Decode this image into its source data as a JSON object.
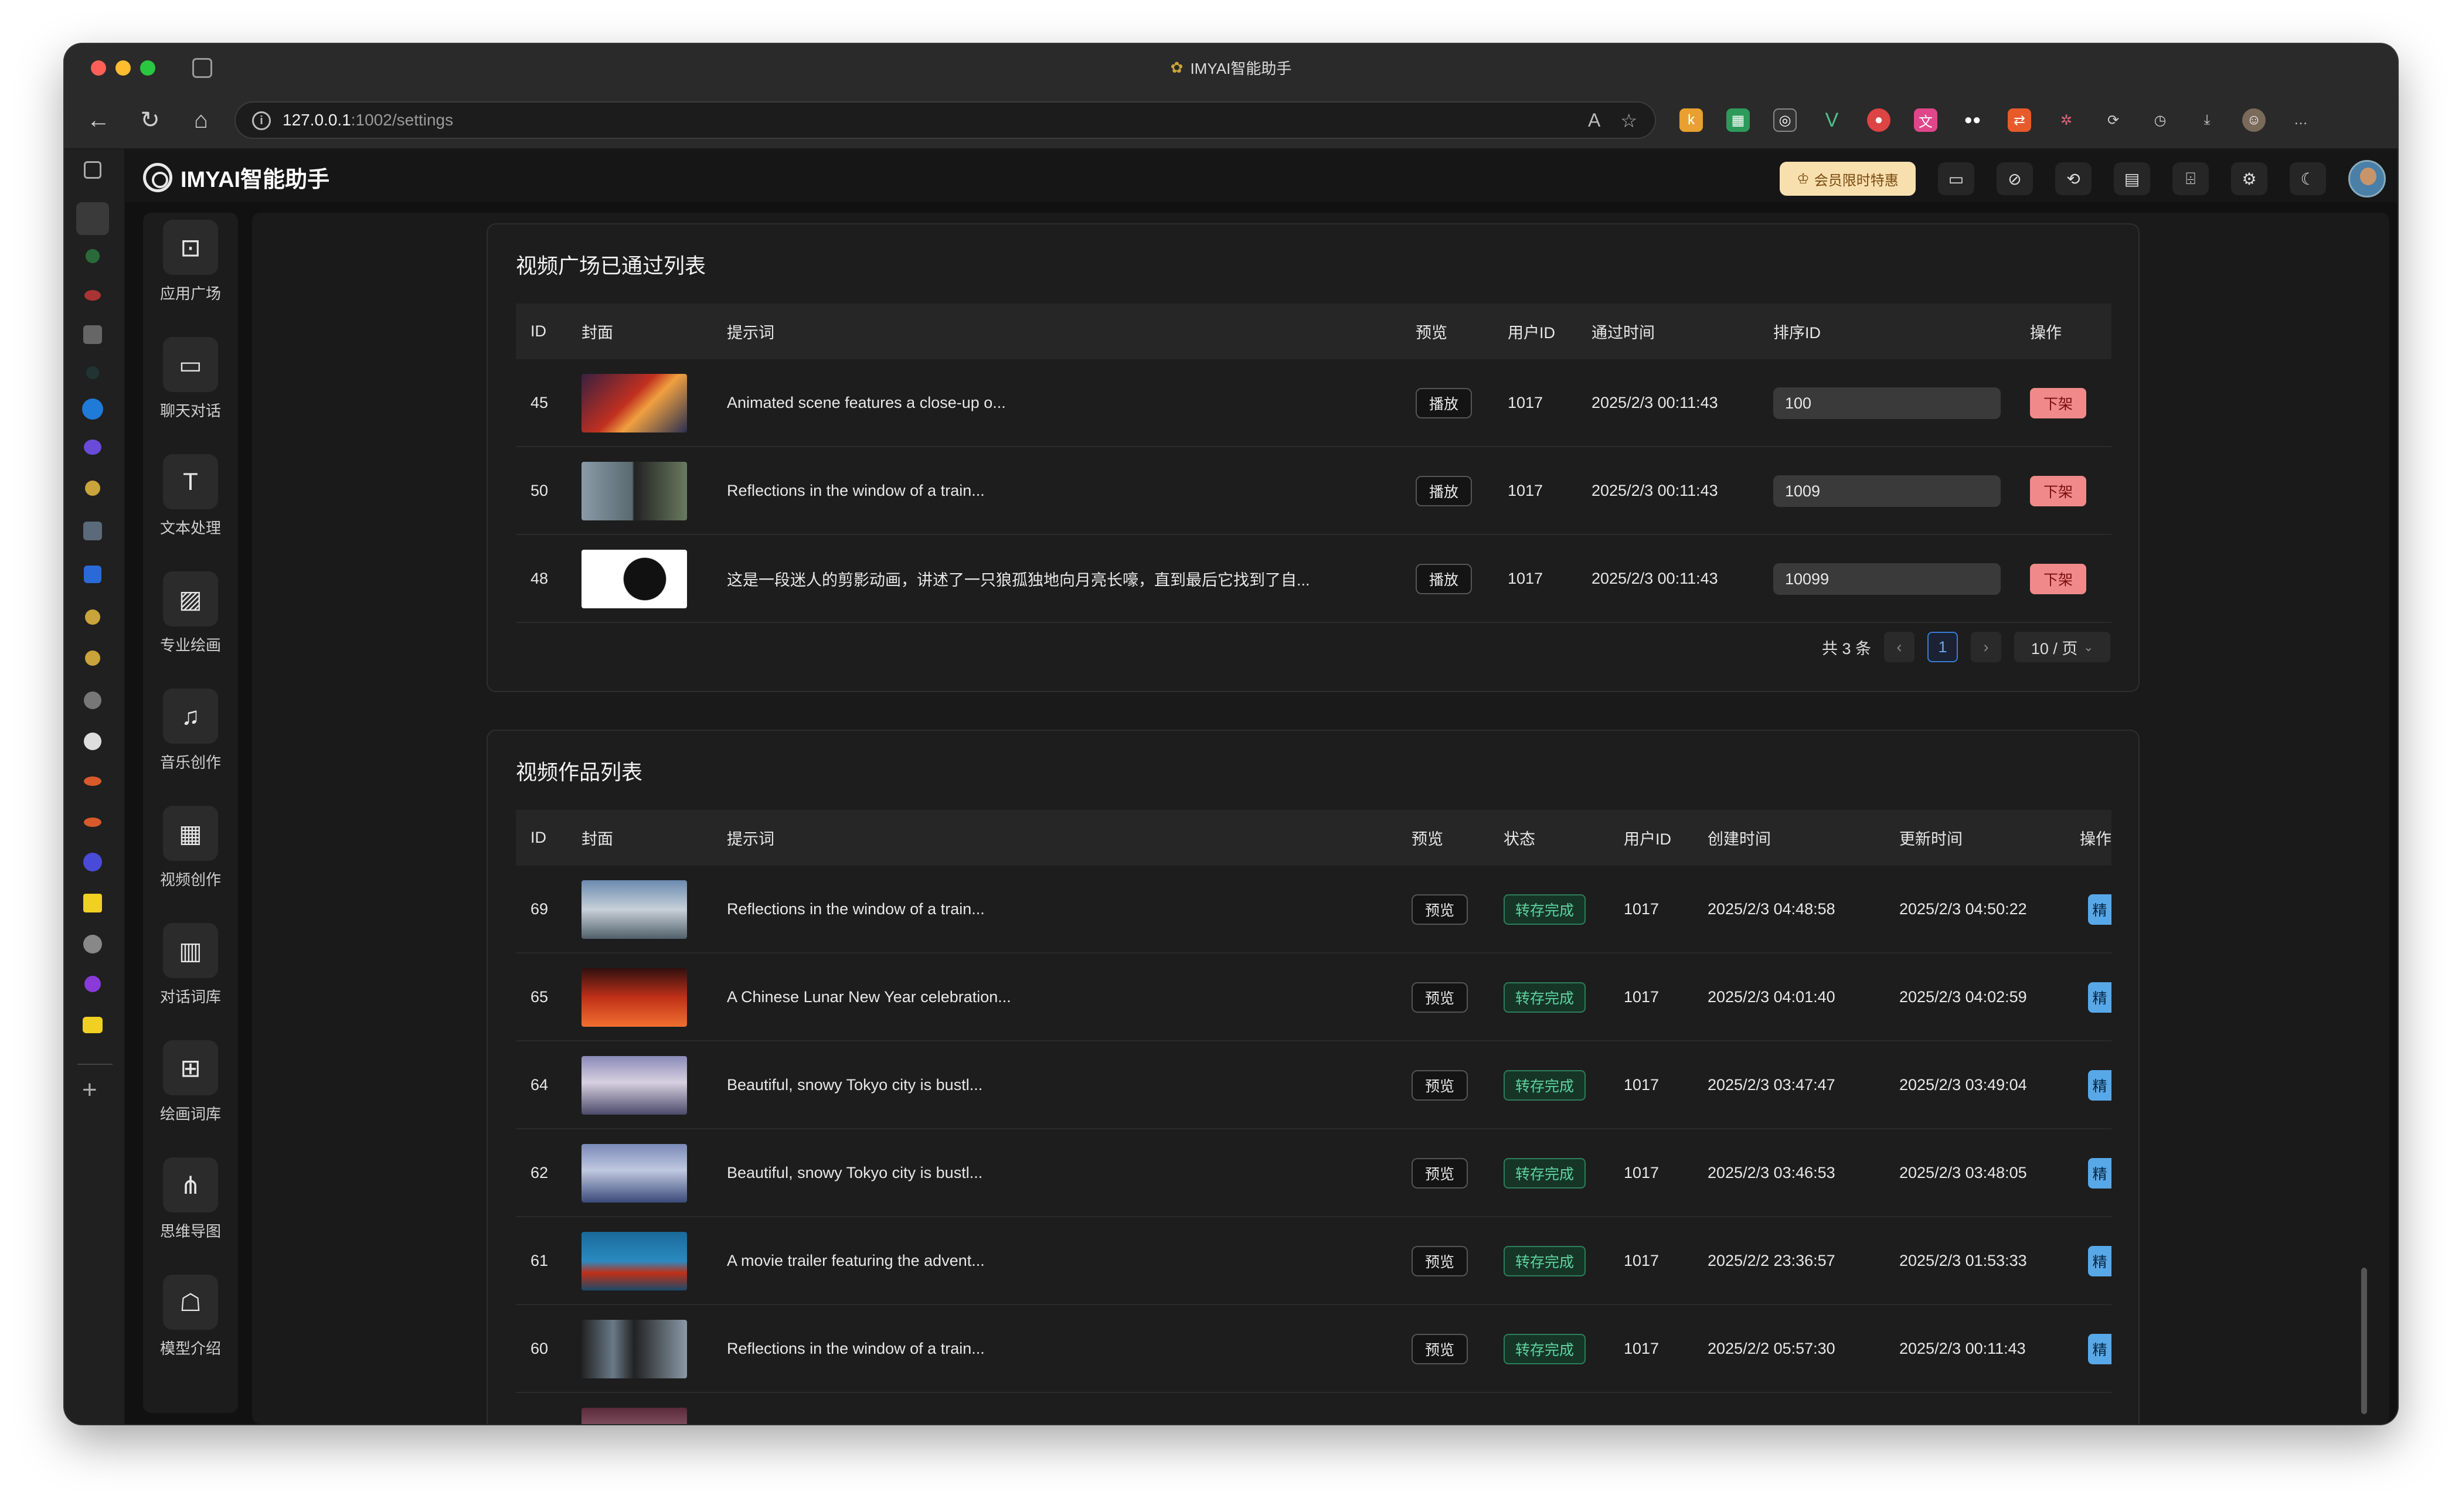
{
  "browser": {
    "window_title": "IMYAI智能助手",
    "url_host": "127.0.0.1",
    "url_path": ":1002/settings"
  },
  "app": {
    "logo_text": "IMYAI智能助手",
    "vip_label": "会员限时特惠"
  },
  "nav": [
    {
      "label": "应用广场",
      "icon": "app-square-icon"
    },
    {
      "label": "聊天对话",
      "icon": "chat-icon"
    },
    {
      "label": "文本处理",
      "icon": "text-icon"
    },
    {
      "label": "专业绘画",
      "icon": "image-icon"
    },
    {
      "label": "音乐创作",
      "icon": "music-icon"
    },
    {
      "label": "视频创作",
      "icon": "video-icon"
    },
    {
      "label": "对话词库",
      "icon": "book-icon"
    },
    {
      "label": "绘画词库",
      "icon": "gallery-icon"
    },
    {
      "label": "思维导图",
      "icon": "mindmap-icon"
    },
    {
      "label": "模型介绍",
      "icon": "robot-icon"
    }
  ],
  "approved": {
    "title": "视频广场已通过列表",
    "headers": {
      "id": "ID",
      "cover": "封面",
      "prompt": "提示词",
      "preview": "预览",
      "user_id": "用户ID",
      "pass_time": "通过时间",
      "sort_id": "排序ID",
      "action": "操作"
    },
    "play_label": "播放",
    "off_label": "下架",
    "rows": [
      {
        "id": "45",
        "prompt": "Animated scene features a close-up o...",
        "user_id": "1017",
        "time": "2025/2/3 00:11:43",
        "sort": "100"
      },
      {
        "id": "50",
        "prompt": "Reflections in the window of a train...",
        "user_id": "1017",
        "time": "2025/2/3 00:11:43",
        "sort": "1009"
      },
      {
        "id": "48",
        "prompt": "这是一段迷人的剪影动画，讲述了一只狼孤独地向月亮长嚎，直到最后它找到了自...",
        "user_id": "1017",
        "time": "2025/2/3 00:11:43",
        "sort": "10099"
      }
    ],
    "pager": {
      "total": "共 3 条",
      "page": "1",
      "size": "10 / 页"
    }
  },
  "works": {
    "title": "视频作品列表",
    "headers": {
      "id": "ID",
      "cover": "封面",
      "prompt": "提示词",
      "preview": "预览",
      "status": "状态",
      "user_id": "用户ID",
      "created": "创建时间",
      "updated": "更新时间",
      "action": "操作"
    },
    "preview_label": "预览",
    "status_label": "转存完成",
    "action_label": "精",
    "rows": [
      {
        "id": "69",
        "prompt": "Reflections in the window of a train...",
        "user_id": "1017",
        "created": "2025/2/3 04:48:58",
        "updated": "2025/2/3 04:50:22"
      },
      {
        "id": "65",
        "prompt": "A Chinese Lunar New Year celebration...",
        "user_id": "1017",
        "created": "2025/2/3 04:01:40",
        "updated": "2025/2/3 04:02:59"
      },
      {
        "id": "64",
        "prompt": "Beautiful, snowy Tokyo city is bustl...",
        "user_id": "1017",
        "created": "2025/2/3 03:47:47",
        "updated": "2025/2/3 03:49:04"
      },
      {
        "id": "62",
        "prompt": "Beautiful, snowy Tokyo city is bustl...",
        "user_id": "1017",
        "created": "2025/2/3 03:46:53",
        "updated": "2025/2/3 03:48:05"
      },
      {
        "id": "61",
        "prompt": "A movie trailer featuring the advent...",
        "user_id": "1017",
        "created": "2025/2/2 23:36:57",
        "updated": "2025/2/3 01:53:33"
      },
      {
        "id": "60",
        "prompt": "Reflections in the window of a train...",
        "user_id": "1017",
        "created": "2025/2/2 05:57:30",
        "updated": "2025/2/3 00:11:43"
      }
    ]
  }
}
